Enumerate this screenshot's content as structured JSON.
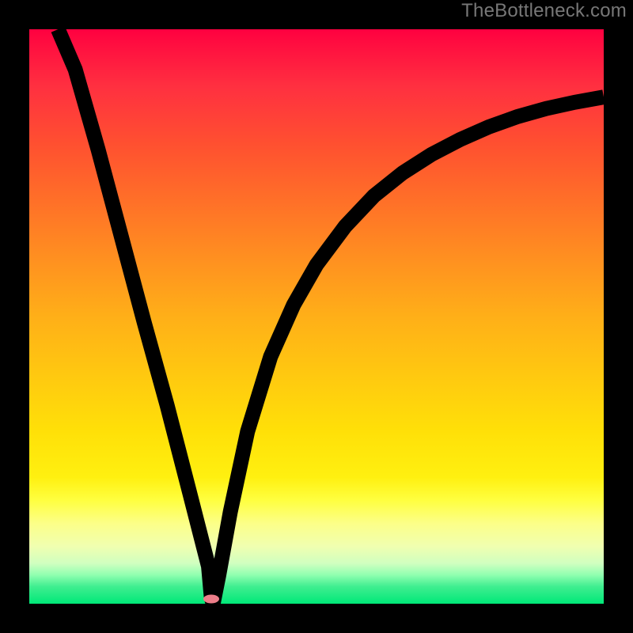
{
  "watermark": "TheBottleneck.com",
  "chart_data": {
    "type": "line",
    "title": "",
    "xlabel": "",
    "ylabel": "",
    "xlim": [
      0,
      100
    ],
    "ylim": [
      0,
      100
    ],
    "grid": false,
    "series": [
      {
        "name": "bottleneck-curve",
        "x": [
          5,
          8,
          12,
          16,
          20,
          24,
          28,
          31.2,
          31.7,
          32,
          33,
          35,
          38,
          42,
          46,
          50,
          55,
          60,
          65,
          70,
          75,
          80,
          85,
          90,
          95,
          100
        ],
        "y": [
          100,
          93,
          79,
          64,
          49,
          34.5,
          19,
          6.5,
          1,
          0,
          5,
          16,
          30,
          43,
          52,
          59,
          65.7,
          71,
          75,
          78.2,
          80.8,
          83,
          84.8,
          86.2,
          87.3,
          88.2
        ]
      }
    ],
    "background_gradient": {
      "top": "#ff0040",
      "mid": "#ffd000",
      "bottom": "#00e878"
    },
    "marker": {
      "x": 31.7,
      "y": 0.8,
      "color": "#ec7d89"
    },
    "axes_color": "#000000"
  }
}
